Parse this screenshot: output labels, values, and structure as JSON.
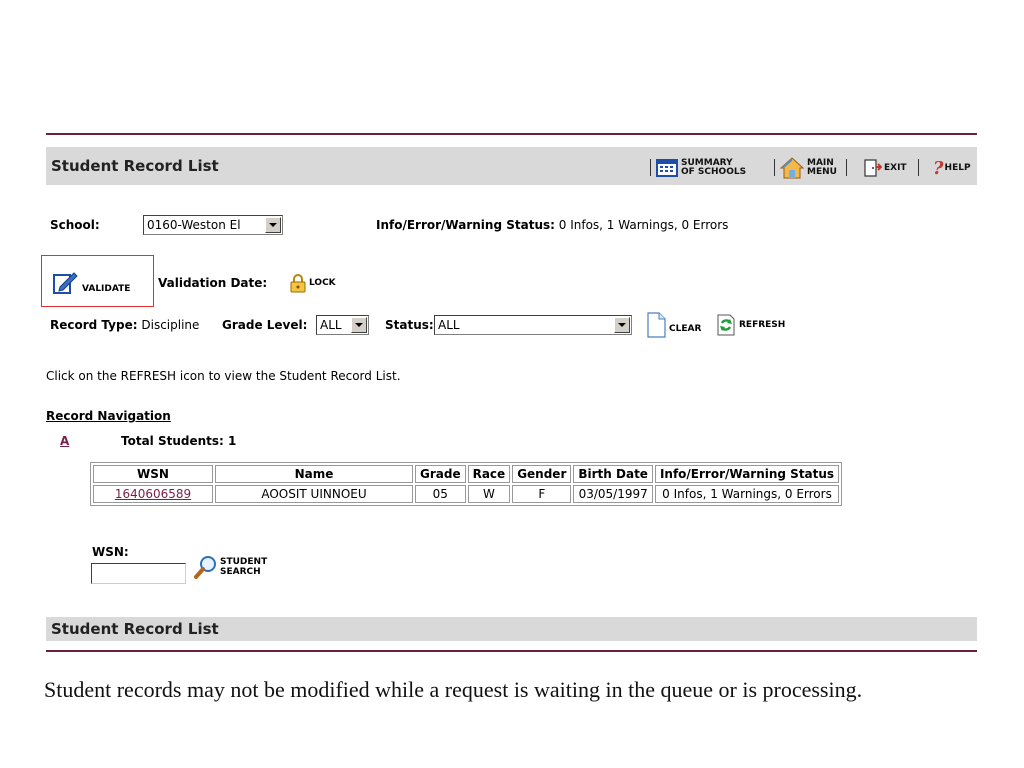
{
  "header": {
    "title": "Student Record List",
    "toolbar": {
      "summary_line1": "SUMMARY",
      "summary_line2": "OF SCHOOLS",
      "main_line1": "MAIN",
      "main_line2": "MENU",
      "exit": "EXIT",
      "help": "HELP"
    }
  },
  "school": {
    "label": "School:",
    "selected": "0160-Weston El"
  },
  "status_info": {
    "label": "Info/Error/Warning Status:",
    "value": "0 Infos, 1 Warnings, 0 Errors"
  },
  "validation": {
    "validate_label": "VALIDATE",
    "date_label": "Validation Date:",
    "lock_label": "LOCK"
  },
  "filters": {
    "record_type_label": "Record Type:",
    "record_type_value": "Discipline",
    "grade_label": "Grade Level:",
    "grade_value": "ALL",
    "status_label": "Status:",
    "status_value": "ALL",
    "clear_label": "CLEAR",
    "refresh_label": "REFRESH"
  },
  "instruction": "Click on the REFRESH icon to view the Student Record List.",
  "navigation": {
    "title": "Record Navigation",
    "letter": "A",
    "total_label": "Total Students: 1"
  },
  "table": {
    "headers": [
      "WSN",
      "Name",
      "Grade",
      "Race",
      "Gender",
      "Birth Date",
      "Info/Error/Warning Status"
    ],
    "rows": [
      [
        "1640606589",
        "AOOSIT UINNOEU",
        "05",
        "W",
        "F",
        "03/05/1997",
        "0 Infos, 1 Warnings, 0 Errors"
      ]
    ]
  },
  "search": {
    "wsn_label": "WSN:",
    "wsn_value": "",
    "button_line1": "STUDENT",
    "button_line2": "SEARCH"
  },
  "footer": {
    "title": "Student Record List",
    "note": "Student records may not be modified while a request is waiting in the queue or is processing."
  },
  "colors": {
    "rule": "#6b1f3a",
    "bar": "#d9d9d9",
    "link": "#7a1f4a",
    "validate_border": "#e03030"
  }
}
